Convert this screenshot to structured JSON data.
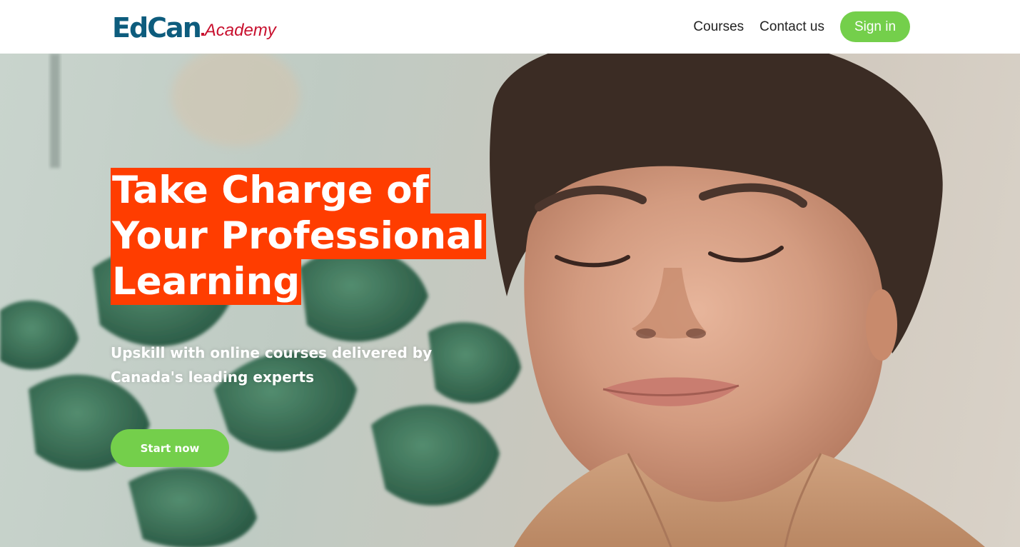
{
  "brand": {
    "name_primary": "EdCan",
    "name_secondary": "Academy",
    "primary_color": "#0d5c7d",
    "secondary_color": "#c8102e"
  },
  "nav": {
    "links": [
      {
        "label": "Courses"
      },
      {
        "label": "Contact us"
      }
    ],
    "signin_label": "Sign in"
  },
  "hero": {
    "headline_lines": [
      "Take Charge of",
      "Your Professional",
      "Learning"
    ],
    "subtext": "Upskill with online courses delivered by Canada's leading experts",
    "cta_label": "Start now",
    "highlight_color": "#ff3d00",
    "button_color": "#74cf4b"
  }
}
